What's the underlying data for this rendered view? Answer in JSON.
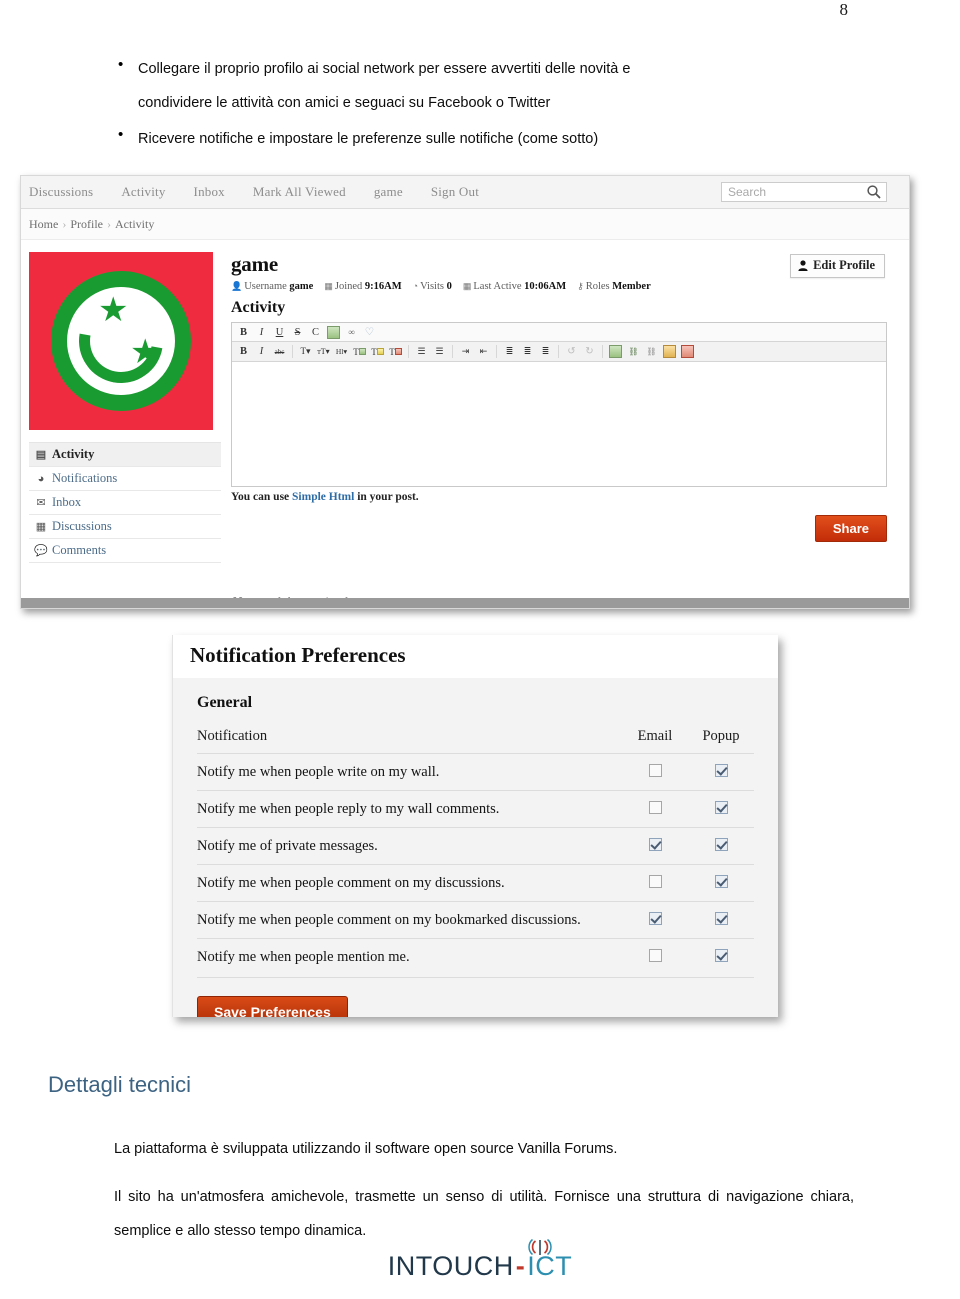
{
  "document": {
    "page_number": "8",
    "bullets": [
      "Collegare il proprio profilo ai social network per essere avvertiti delle novità e condividere le attività con amici e seguaci su Facebook o Twitter",
      "Ricevere notifiche e impostare le preferenze sulle notifiche (come sotto)"
    ],
    "bullet_lines": {
      "b1_line1": "Collegare il proprio profilo ai social network per essere avvertiti delle novità e",
      "b1_line2": "condividere le attività con amici e seguaci su Facebook o Twitter",
      "b2_line1": "Ricevere notifiche e impostare le preferenze sulle notifiche (come sotto)"
    },
    "bullet_glyph": "•",
    "section_heading": "Dettagli tecnici",
    "section_heading_color": "#3d6383",
    "paragraphs": [
      "La piattaforma è sviluppata utilizzando il software open source Vanilla Forums.",
      "Il sito ha un'atmosfera amichevole, trasmette un senso di utilità. Fornisce una struttura di navigazione chiara, semplice e allo stesso tempo dinamica."
    ],
    "footer_logo": {
      "part1": "INTOUCH",
      "dash": "-",
      "part2": "ICT",
      "icon": "antenna-signal-icon"
    }
  },
  "forum_screenshot": {
    "navbar": {
      "items": [
        {
          "label": "Discussions",
          "name": "nav-discussions"
        },
        {
          "label": "Activity",
          "name": "nav-activity"
        },
        {
          "label": "Inbox",
          "name": "nav-inbox"
        },
        {
          "label": "Mark All Viewed",
          "name": "nav-mark-all-viewed"
        },
        {
          "label": "game",
          "name": "nav-username"
        },
        {
          "label": "Sign Out",
          "name": "nav-sign-out"
        }
      ],
      "search_placeholder": "Search",
      "search_value": ""
    },
    "breadcrumb": {
      "items": [
        "Home",
        "Profile",
        "Activity"
      ],
      "separator": "›"
    },
    "profile": {
      "username_heading": "game",
      "edit_profile_label": "Edit Profile",
      "meta": [
        {
          "icon": "user-icon",
          "label": "Username",
          "value": "game"
        },
        {
          "icon": "calendar-icon",
          "label": "Joined",
          "value": "9:16AM"
        },
        {
          "icon": "clock-icon",
          "label": "Visits",
          "value": "0"
        },
        {
          "icon": "calendar-icon",
          "label": "Last Active",
          "value": "10:06AM"
        },
        {
          "icon": "key-icon",
          "label": "Roles",
          "value": "Member"
        }
      ],
      "avatar": {
        "name": "user-avatar",
        "background": "#ef2b40",
        "foreground": "#1a9b31",
        "description": "green smiley with two stars on red background"
      }
    },
    "sidebar": {
      "items": [
        {
          "label": "Activity",
          "icon": "activity-icon",
          "active": true
        },
        {
          "label": "Notifications",
          "icon": "bell-icon",
          "active": false
        },
        {
          "label": "Inbox",
          "icon": "envelope-icon",
          "active": false
        },
        {
          "label": "Discussions",
          "icon": "calendar-icon",
          "active": false
        },
        {
          "label": "Comments",
          "icon": "comment-icon",
          "active": false
        }
      ]
    },
    "activity": {
      "section_title": "Activity",
      "editor": {
        "toolbar_row1": [
          {
            "glyph": "B",
            "name": "bold-icon"
          },
          {
            "glyph": "I",
            "name": "italic-icon"
          },
          {
            "glyph": "U",
            "name": "underline-icon"
          },
          {
            "glyph": "S",
            "name": "strikethrough-icon"
          },
          {
            "glyph": "C",
            "name": "code-icon"
          },
          {
            "glyph": "▤",
            "name": "image-icon"
          },
          {
            "glyph": "∞",
            "name": "link-icon"
          },
          {
            "glyph": "♡",
            "name": "quote-icon"
          }
        ],
        "toolbar_row2": [
          {
            "glyph": "B",
            "name": "bold-icon"
          },
          {
            "glyph": "I",
            "name": "italic-icon"
          },
          {
            "glyph": "abc",
            "name": "strikethrough-icon"
          },
          {
            "glyph": "T▾",
            "name": "font-family-icon"
          },
          {
            "glyph": "тT▾",
            "name": "font-size-icon"
          },
          {
            "glyph": "Hl▾",
            "name": "heading-icon"
          },
          {
            "glyph": "T",
            "name": "text-color-icon"
          },
          {
            "glyph": "T",
            "name": "highlight-color-icon"
          },
          {
            "glyph": "T",
            "name": "clear-formatting-icon"
          },
          {
            "glyph": "☰",
            "name": "bullet-list-icon"
          },
          {
            "glyph": "☰",
            "name": "numbered-list-icon"
          },
          {
            "glyph": "⇥",
            "name": "indent-icon"
          },
          {
            "glyph": "⇤",
            "name": "outdent-icon"
          },
          {
            "glyph": "≡",
            "name": "align-left-icon"
          },
          {
            "glyph": "≡",
            "name": "align-center-icon"
          },
          {
            "glyph": "≡",
            "name": "align-right-icon"
          },
          {
            "glyph": "↺",
            "name": "undo-icon"
          },
          {
            "glyph": "↻",
            "name": "redo-icon"
          },
          {
            "glyph": "▣",
            "name": "insert-image-icon"
          },
          {
            "glyph": "⛓",
            "name": "insert-link-icon"
          },
          {
            "glyph": "⛓",
            "name": "unlink-icon"
          },
          {
            "glyph": "▤",
            "name": "anchor-icon"
          },
          {
            "glyph": "◇",
            "name": "source-code-icon"
          }
        ],
        "body_value": "",
        "hint_prefix": "You can use ",
        "hint_link": "Simple Html",
        "hint_suffix": " in your post.",
        "share_label": "Share"
      },
      "empty_message": "Not much happening here, yet."
    }
  },
  "notification_prefs_screenshot": {
    "title": "Notification Preferences",
    "section": "General",
    "columns": {
      "notification": "Notification",
      "email": "Email",
      "popup": "Popup"
    },
    "rows": [
      {
        "label": "Notify me when people write on my wall.",
        "email": false,
        "popup": true
      },
      {
        "label": "Notify me when people reply to my wall comments.",
        "email": false,
        "popup": true
      },
      {
        "label": "Notify me of private messages.",
        "email": true,
        "popup": true
      },
      {
        "label": "Notify me when people comment on my discussions.",
        "email": false,
        "popup": true
      },
      {
        "label": "Notify me when people comment on my bookmarked discussions.",
        "email": true,
        "popup": true
      },
      {
        "label": "Notify me when people mention me.",
        "email": false,
        "popup": true
      }
    ],
    "save_label": "Save Preferences",
    "save_color": "#c2380e"
  }
}
